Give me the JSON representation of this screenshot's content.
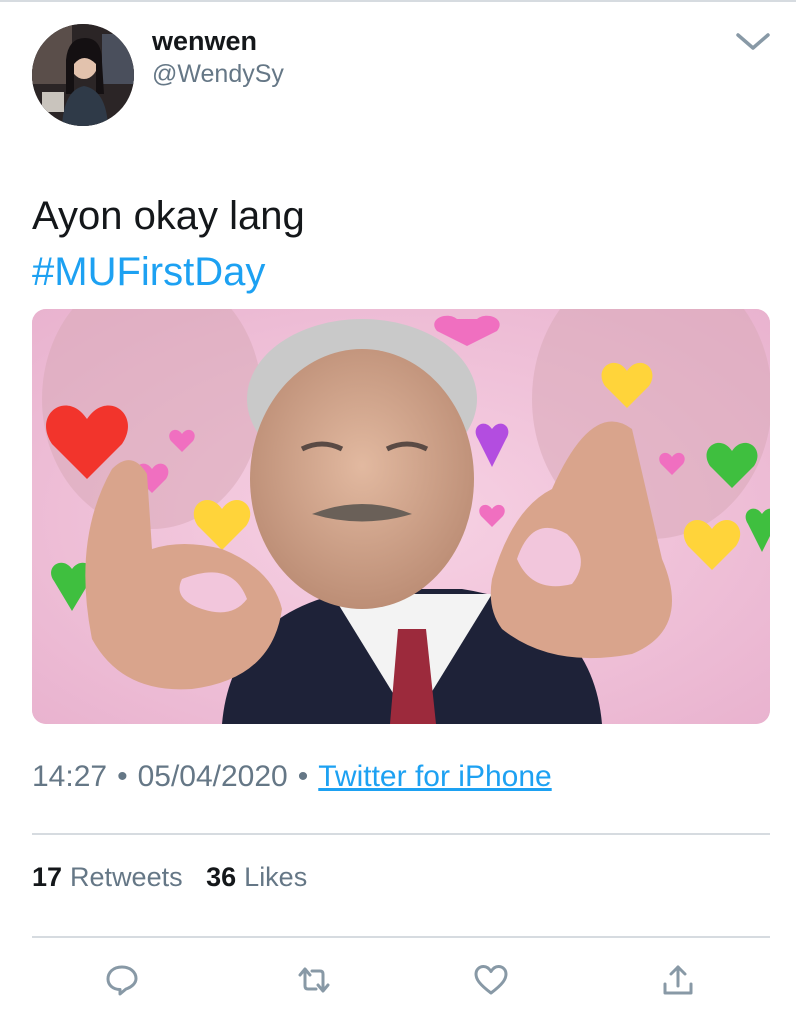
{
  "user": {
    "name": "wenwen",
    "handle": "@WendySy"
  },
  "tweet": {
    "text": "Ayon okay lang",
    "hashtag": "#MUFirstDay"
  },
  "meta": {
    "time": "14:27",
    "separator": "•",
    "date": "05/04/2020",
    "source": "Twitter for iPhone"
  },
  "stats": {
    "retweets_count": "17",
    "retweets_label": "Retweets",
    "likes_count": "36",
    "likes_label": "Likes"
  },
  "icons": {
    "menu": "chevron-down-icon",
    "reply": "reply-icon",
    "retweet": "retweet-icon",
    "like": "heart-icon",
    "share": "share-icon"
  },
  "colors": {
    "link": "#1da1f2",
    "secondary_text": "#657786",
    "primary_text": "#14171a",
    "divider": "#d6dbe0",
    "media_background": "#f2c6dc"
  }
}
